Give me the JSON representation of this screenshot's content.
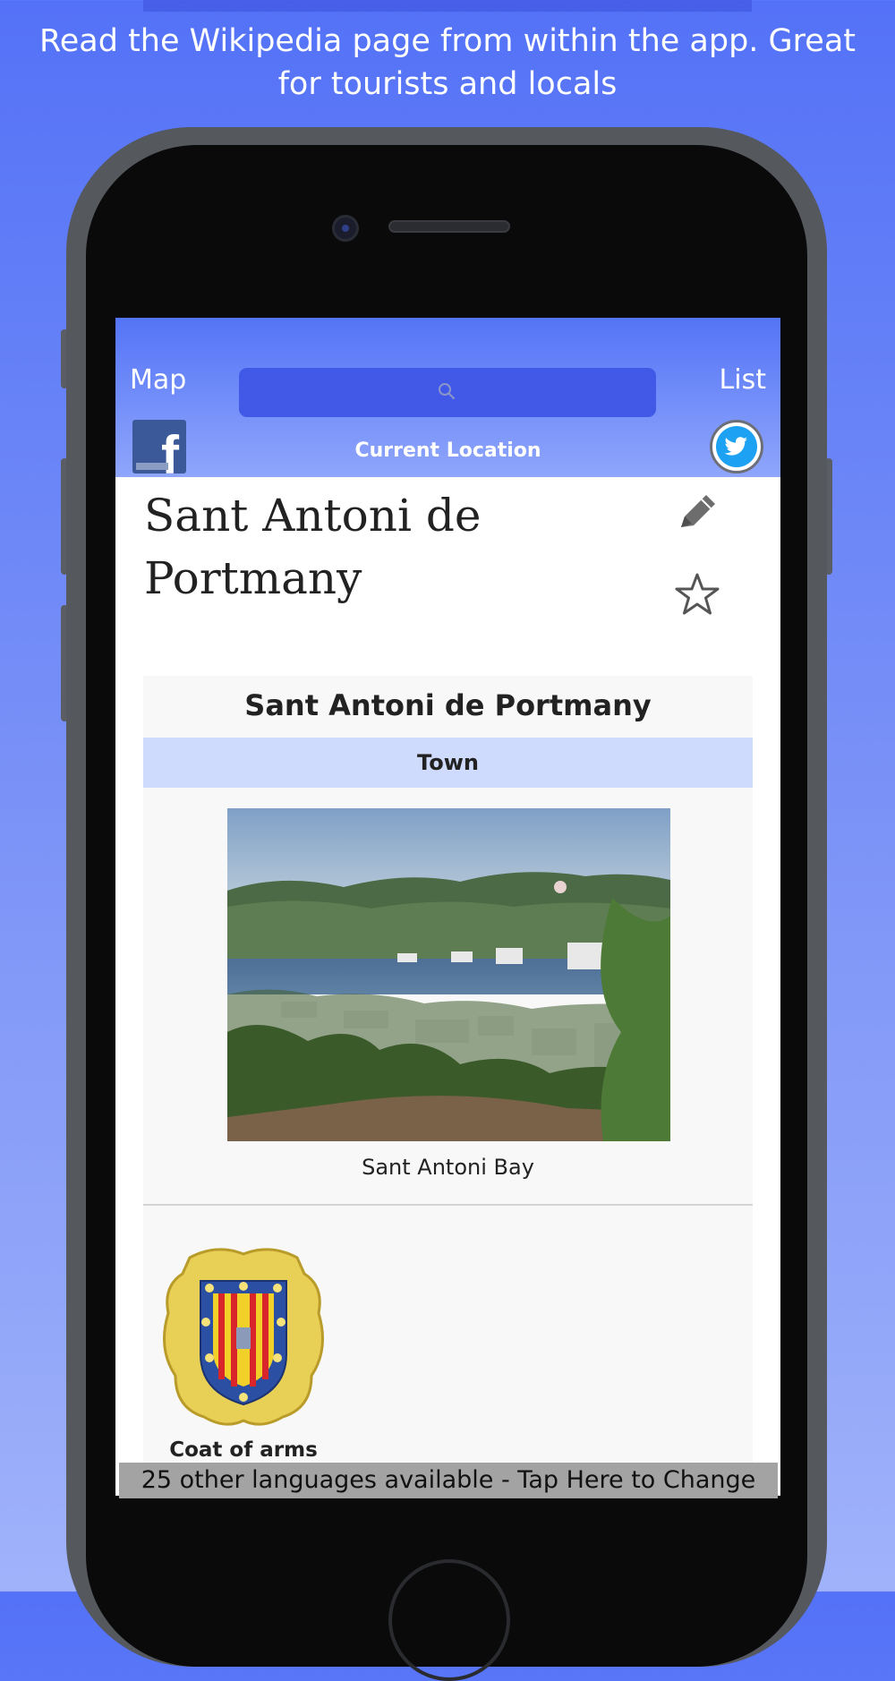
{
  "headline": "Read the Wikipedia page from within the app. Great for tourists and locals",
  "nav": {
    "map_label": "Map",
    "list_label": "List",
    "search_placeholder": "",
    "current_location": "Current Location",
    "facebook_letter": "f"
  },
  "article": {
    "title": "Sant Antoni de Portmany"
  },
  "infobox": {
    "title": "Sant Antoni de Portmany",
    "type": "Town",
    "photo_caption": "Sant Antoni Bay",
    "coat_label": "Coat of arms"
  },
  "language_bar": "25 other languages available - Tap Here to Change",
  "colors": {
    "navbar_top": "#5474f7",
    "infobox_header": "#cedbfc",
    "facebook": "#3b5998",
    "twitter": "#1da1f2"
  },
  "icons": [
    "search-icon",
    "facebook-icon",
    "twitter-icon",
    "pencil-icon",
    "star-icon"
  ]
}
